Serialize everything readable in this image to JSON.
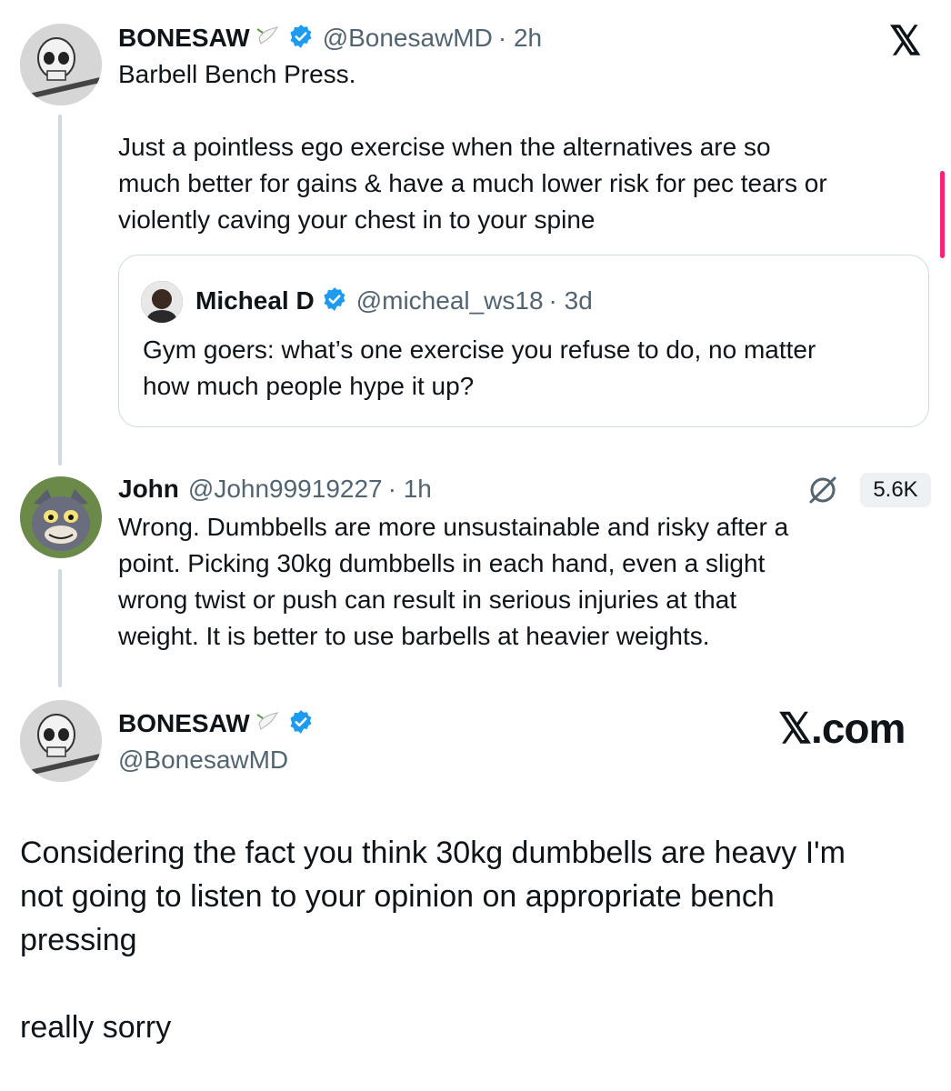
{
  "tweet1": {
    "display_name": "BONESAW",
    "name_emoji": "dove",
    "handle": "@BonesawMD",
    "time": "· 2h",
    "text": "Barbell Bench Press.\n\nJust a pointless ego exercise when the alternatives are so\nmuch better for gains & have a much lower risk for pec tears or\nviolently caving your chest in to your spine"
  },
  "quote": {
    "display_name": "Micheal D",
    "handle": "@micheal_ws18",
    "time": "· 3d",
    "text": "Gym goers: what’s one exercise you refuse to do, no matter\nhow much people hype it up?"
  },
  "reply": {
    "display_name": "John",
    "handle": "@John99919227",
    "time": "· 1h",
    "views": "5.6K",
    "text": "Wrong. Dumbbells are more unsustainable and risky after a\npoint. Picking 30kg dumbbells in each hand, even a slight\nwrong twist or push can result in serious injuries at that\nweight. It is better to use barbells at heavier weights."
  },
  "tweet2": {
    "display_name": "BONESAW",
    "handle": "@BonesawMD",
    "brand": "𝕏.com",
    "text": "Considering the fact you think 30kg dumbbells are heavy I'm\nnot going to listen to your opinion on appropriate bench\npressing\n\nreally sorry"
  },
  "top_logo": "𝕏",
  "colors": {
    "verified": "#1d9bf0",
    "secondary_text": "#536471",
    "thread_line": "#cfd9de",
    "scroll_accent": "#f4247c"
  },
  "icons": {
    "close_logo": "x-logo-icon",
    "verified": "verified-badge-icon",
    "dove": "dove-emoji-icon",
    "ai": "grok-icon"
  }
}
